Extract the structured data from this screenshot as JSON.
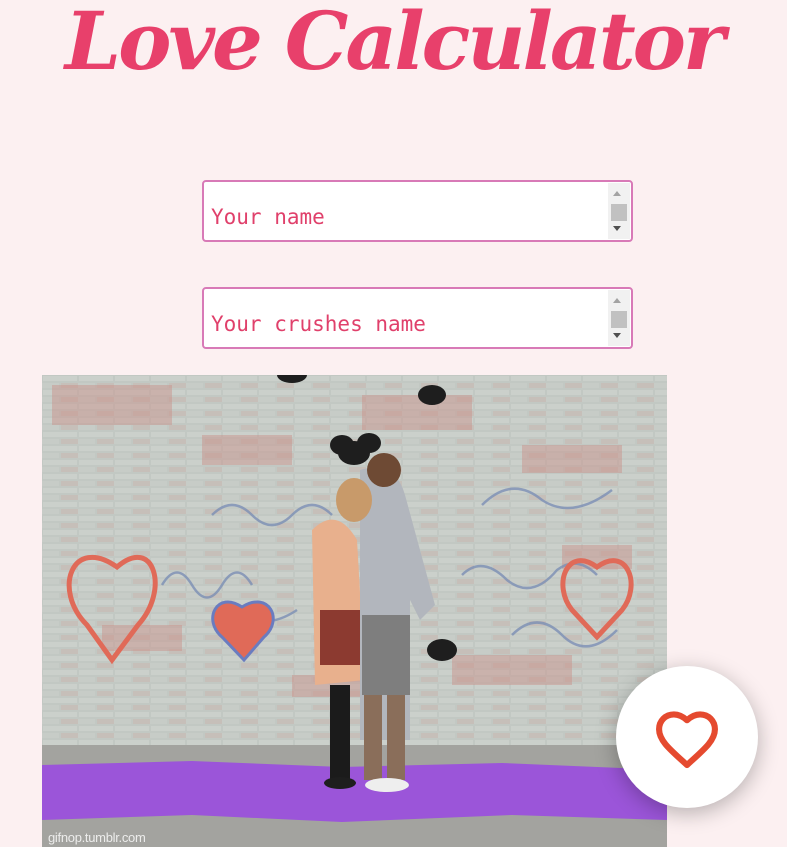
{
  "app": {
    "title": "Love Calculator"
  },
  "form": {
    "name_placeholder": "Your name",
    "crush_placeholder": "Your crushes name"
  },
  "image": {
    "watermark": "gifnop.tumblr.com"
  },
  "colors": {
    "background": "#fcf0f1",
    "title": "#e8406b",
    "input_border": "#d87ab7",
    "input_text": "#e0406b",
    "heart": "#e54a2f",
    "tarp": "#9b55d9"
  },
  "icons": {
    "action_button": "heart-outline-icon"
  }
}
